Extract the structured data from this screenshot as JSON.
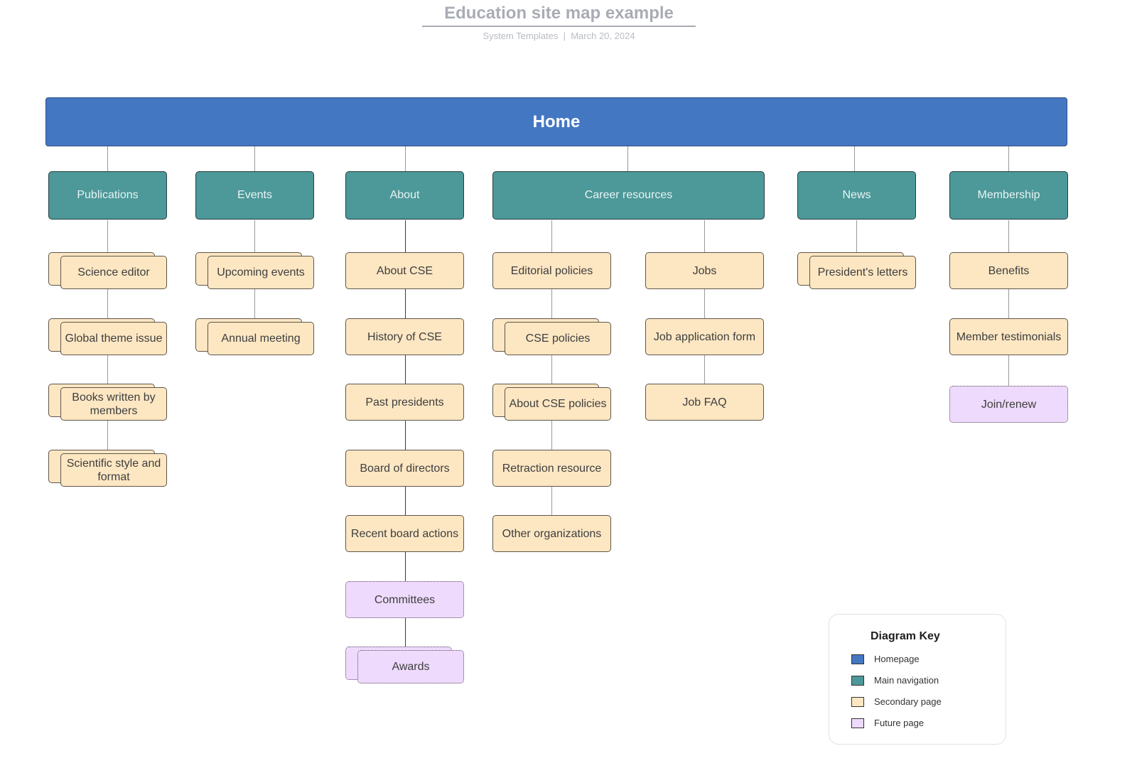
{
  "header": {
    "title": "Education site map example",
    "subtitle": "System Templates  |  March 20, 2024"
  },
  "colors": {
    "homepage": "#4477c2",
    "main_navigation": "#4d9899",
    "secondary_page": "#fde7c3",
    "future_page": "#eedafc"
  },
  "home": {
    "label": "Home"
  },
  "nav": [
    {
      "label": "Publications"
    },
    {
      "label": "Events"
    },
    {
      "label": "About"
    },
    {
      "label": "Career resources"
    },
    {
      "label": "News"
    },
    {
      "label": "Membership"
    }
  ],
  "publications": [
    {
      "label": "Science editor",
      "type": "secondary",
      "stacked": true
    },
    {
      "label": "Global theme issue",
      "type": "secondary",
      "stacked": true
    },
    {
      "label": "Books written by members",
      "type": "secondary",
      "stacked": true
    },
    {
      "label": "Scientific style and format",
      "type": "secondary",
      "stacked": true
    }
  ],
  "events": [
    {
      "label": "Upcoming events",
      "type": "secondary",
      "stacked": true
    },
    {
      "label": "Annual meeting",
      "type": "secondary",
      "stacked": true
    }
  ],
  "about": [
    {
      "label": "About CSE",
      "type": "secondary",
      "stacked": false
    },
    {
      "label": "History of CSE",
      "type": "secondary",
      "stacked": false
    },
    {
      "label": "Past presidents",
      "type": "secondary",
      "stacked": false
    },
    {
      "label": "Board of directors",
      "type": "secondary",
      "stacked": false
    },
    {
      "label": "Recent board actions",
      "type": "secondary",
      "stacked": false
    },
    {
      "label": "Committees",
      "type": "future",
      "stacked": false
    },
    {
      "label": "Awards",
      "type": "future",
      "stacked": true
    }
  ],
  "career_editorial": [
    {
      "label": "Editorial policies",
      "type": "secondary",
      "stacked": false
    },
    {
      "label": "CSE policies",
      "type": "secondary",
      "stacked": true
    },
    {
      "label": "About CSE policies",
      "type": "secondary",
      "stacked": true
    },
    {
      "label": "Retraction resource",
      "type": "secondary",
      "stacked": false
    },
    {
      "label": "Other organizations",
      "type": "secondary",
      "stacked": false
    }
  ],
  "career_jobs": [
    {
      "label": "Jobs",
      "type": "secondary",
      "stacked": false
    },
    {
      "label": "Job application form",
      "type": "secondary",
      "stacked": false
    },
    {
      "label": "Job FAQ",
      "type": "secondary",
      "stacked": false
    }
  ],
  "news": [
    {
      "label": "President's letters",
      "type": "secondary",
      "stacked": true
    }
  ],
  "membership": [
    {
      "label": "Benefits",
      "type": "secondary",
      "stacked": false
    },
    {
      "label": "Member testimonials",
      "type": "secondary",
      "stacked": false
    },
    {
      "label": "Join/renew",
      "type": "future",
      "stacked": false
    }
  ],
  "legend": {
    "title": "Diagram Key",
    "items": [
      {
        "label": "Homepage",
        "color": "#4477c2"
      },
      {
        "label": "Main navigation",
        "color": "#4d9899"
      },
      {
        "label": "Secondary page",
        "color": "#fde7c3"
      },
      {
        "label": "Future page",
        "color": "#eedafc"
      }
    ]
  }
}
